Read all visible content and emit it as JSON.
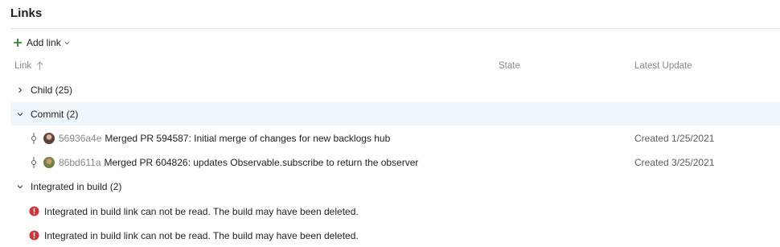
{
  "section": {
    "title": "Links"
  },
  "toolbar": {
    "add_link_label": "Add link"
  },
  "columns": {
    "link": "Link",
    "state": "State",
    "latest_update": "Latest Update"
  },
  "groups": {
    "child": {
      "label": "Child (25)"
    },
    "commit": {
      "label": "Commit (2)"
    },
    "integrated": {
      "label": "Integrated in build (2)"
    }
  },
  "commits": [
    {
      "hash": "56936a4e",
      "message": "Merged PR 594587: Initial merge of changes for new backlogs hub",
      "updated": "Created 1/25/2021"
    },
    {
      "hash": "86bd611a",
      "message": "Merged PR 604826: updates Observable.subscribe to return the observer",
      "updated": "Created 3/25/2021"
    }
  ],
  "build_errors": [
    {
      "message": "Integrated in build link can not be read. The build may have been deleted."
    },
    {
      "message": "Integrated in build link can not be read. The build may have been deleted."
    }
  ],
  "colors": {
    "accent_green": "#107c10",
    "error_red": "#d13438",
    "selected_row": "#eff6fc",
    "muted_text": "#8a8886"
  },
  "icons": [
    "plus-icon",
    "chevron-down-icon",
    "sort-up-arrow-icon",
    "chevron-right-icon",
    "commit-icon",
    "error-icon"
  ]
}
